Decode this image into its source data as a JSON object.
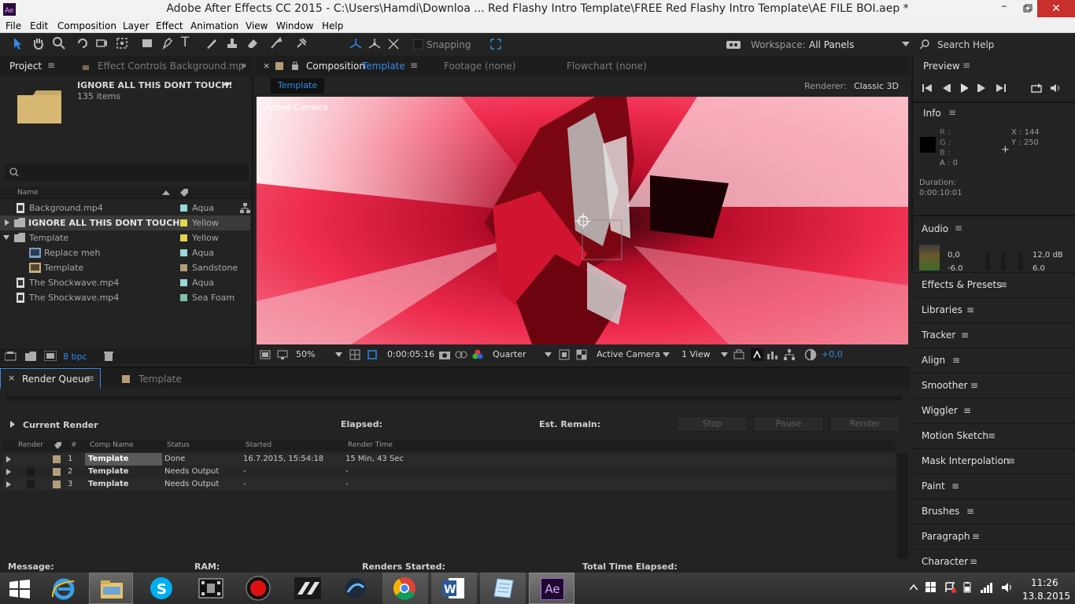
{
  "title_bar": {
    "title": "Adobe After Effects CC 2015 - C:\\Users\\Hamdi\\Downloa ...  Red Flashy Intro Template\\FREE Red Flashy Intro Template\\AE FILE BOI.aep *"
  },
  "menu": [
    "File",
    "Edit",
    "Composition",
    "Layer",
    "Effect",
    "Animation",
    "View",
    "Window",
    "Help"
  ],
  "toolbar": {
    "snapping_label": "Snapping",
    "workspace_label": "Workspace:",
    "workspace_value": "All Panels",
    "search_help": "Search Help"
  },
  "project_panel": {
    "tab_project": "Project",
    "tab_effect_controls": "Effect Controls Background.mp",
    "folder_title": "IGNORE ALL THIS DONT TOUCH!",
    "item_count": "135 items",
    "col_name": "Name",
    "bpc": "8 bpc",
    "items": [
      {
        "name": "Background.mp4",
        "label": "Aqua",
        "color": "#9ad7d7",
        "kind": "footage"
      },
      {
        "name": "IGNORE ALL THIS DONT TOUCH!",
        "label": "Yellow",
        "color": "#e3d64a",
        "kind": "folder"
      },
      {
        "name": "Template",
        "label": "Yellow",
        "color": "#e3d64a",
        "kind": "folder-open"
      },
      {
        "name": "Replace meh",
        "label": "Aqua",
        "color": "#9ad7d7",
        "kind": "comp"
      },
      {
        "name": "Template",
        "label": "Sandstone",
        "color": "#b39d79",
        "kind": "comp"
      },
      {
        "name": "The Shockwave.mp4",
        "label": "Aqua",
        "color": "#9ad7d7",
        "kind": "footage"
      },
      {
        "name": "The Shockwave.mp4",
        "label": "Sea Foam",
        "color": "#7fc3a6",
        "kind": "footage"
      }
    ]
  },
  "comp_panel": {
    "tab_composition": "Composition",
    "comp_name": "Template",
    "tab_footage": "Footage (none)",
    "tab_flowchart": "Flowchart (none)",
    "chip": "Template",
    "renderer_label": "Renderer:",
    "renderer_value": "Classic 3D",
    "active_camera_overlay": "Active Camera",
    "zoom": "50%",
    "timecode": "0:00:05:16",
    "resolution": "Quarter",
    "camera": "Active Camera",
    "views": "1 View",
    "exposure": "+0,0"
  },
  "preview": {
    "title": "Preview"
  },
  "info": {
    "title": "Info",
    "r": "R :",
    "g": "G :",
    "b": "B :",
    "a": "A : 0",
    "x": "X : 144",
    "y": "Y : 250",
    "duration_label": "Duration:",
    "duration_value": "0:00:10:01"
  },
  "audio": {
    "title": "Audio",
    "left_db": "0,0",
    "right_db": "12,0 dB",
    "left_db2": "-6,0",
    "right_db2": "6,0"
  },
  "right_panels": [
    "Effects & Presets",
    "Libraries",
    "Tracker",
    "Align",
    "Smoother",
    "Wiggler",
    "Motion Sketch",
    "Mask Interpolation",
    "Paint",
    "Brushes",
    "Paragraph",
    "Character"
  ],
  "render_queue": {
    "tab_render_queue": "Render Queue",
    "tab_template": "Template",
    "current_render": "Current Render",
    "elapsed": "Elapsed:",
    "est_remain": "Est. Remain:",
    "btn_stop": "Stop",
    "btn_pause": "Pause",
    "btn_render": "Render",
    "headers": {
      "render": "Render",
      "num": "#",
      "comp": "Comp Name",
      "status": "Status",
      "started": "Started",
      "time": "Render Time"
    },
    "rows": [
      {
        "num": "1",
        "comp": "Template",
        "status": "Done",
        "started": "16.7.2015, 15:54:18",
        "time": "15 Min, 43 Sec"
      },
      {
        "num": "2",
        "comp": "Template",
        "status": "Needs Output",
        "started": "-",
        "time": "-"
      },
      {
        "num": "3",
        "comp": "Template",
        "status": "Needs Output",
        "started": "-",
        "time": "-"
      }
    ],
    "footer": {
      "message": "Message:",
      "ram": "RAM:",
      "renders_started": "Renders Started:",
      "total_elapsed": "Total Time Elapsed:"
    }
  },
  "taskbar": {
    "ae_label": "Ae",
    "time": "11:26",
    "date": "13.8.2015"
  },
  "colors": {
    "accent_blue": "#2d8ceb",
    "panel_bg": "#232323",
    "tab_bg": "#1d1d1d",
    "viewer_red": "#e8153a"
  }
}
